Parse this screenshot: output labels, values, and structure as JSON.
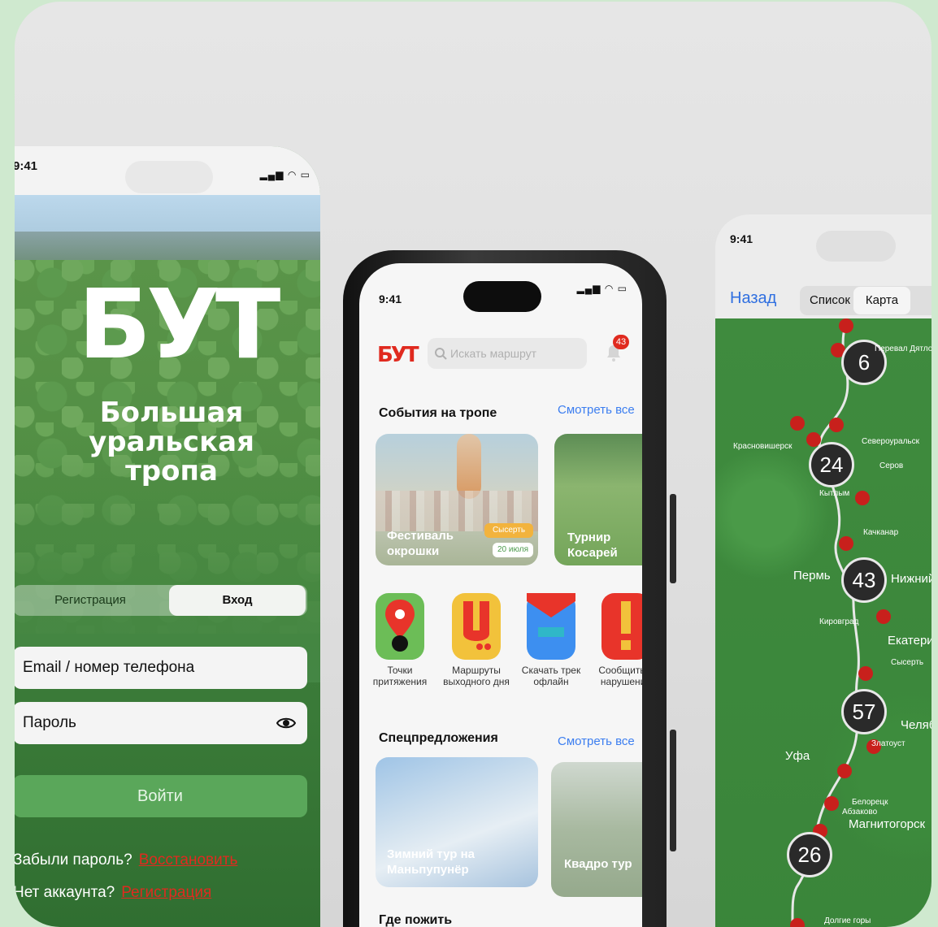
{
  "login_screen": {
    "status_time": "9:41",
    "logo": "БУТ",
    "title": "Большая уральская тропа",
    "tabs": [
      "Регистрация",
      "Вход"
    ],
    "email_placeholder": "Email / номер телефона",
    "password_placeholder": "Пароль",
    "login_button": "Войти",
    "forgot_text": "Забыли пароль?",
    "forgot_link": "Восстановить",
    "no_account_text": "Нет аккаунта?",
    "register_link": "Регистрация"
  },
  "main_screen": {
    "status_time": "9:41",
    "brand": "БУТ",
    "search_placeholder": "Искать маршрут",
    "notification_count": "43",
    "events": {
      "title": "События на тропе",
      "see_all": "Смотреть все",
      "cards": [
        {
          "title": "Фестиваль окрошки",
          "tag": "Сысерть",
          "date": "20 июля"
        },
        {
          "title": "Турнир Косарей"
        }
      ]
    },
    "quick_actions": [
      {
        "label": "Точки притяжения",
        "icon": "map-pin-icon"
      },
      {
        "label": "Маршруты выходного дня",
        "icon": "route-icon"
      },
      {
        "label": "Скачать трек офлайн",
        "icon": "download-track-icon"
      },
      {
        "label": "Сообщить о нарушении",
        "icon": "warning-icon"
      }
    ],
    "offers": {
      "title": "Спецпредложения",
      "see_all": "Смотреть все",
      "cards": [
        {
          "title": "Зимний тур на Маньпупунёр"
        },
        {
          "title": "Квадро тур"
        }
      ]
    },
    "stay": {
      "title": "Где пожить"
    }
  },
  "map_screen": {
    "status_time": "9:41",
    "back": "Назад",
    "tabs": [
      "Список",
      "Карта"
    ],
    "clusters": [
      "6",
      "24",
      "43",
      "57",
      "26"
    ],
    "cities": [
      "Перевал Дятлова",
      "Красновишерск",
      "Североуральск",
      "Серов",
      "Кытлым",
      "Качканар",
      "Пермь",
      "Нижний Тагил",
      "Кировград",
      "Екатеринбург",
      "Сысерть",
      "Челябинск",
      "Златоуст",
      "Уфа",
      "Белорецк",
      "Абзаково",
      "Магнитогорск",
      "Долгие горы"
    ]
  }
}
